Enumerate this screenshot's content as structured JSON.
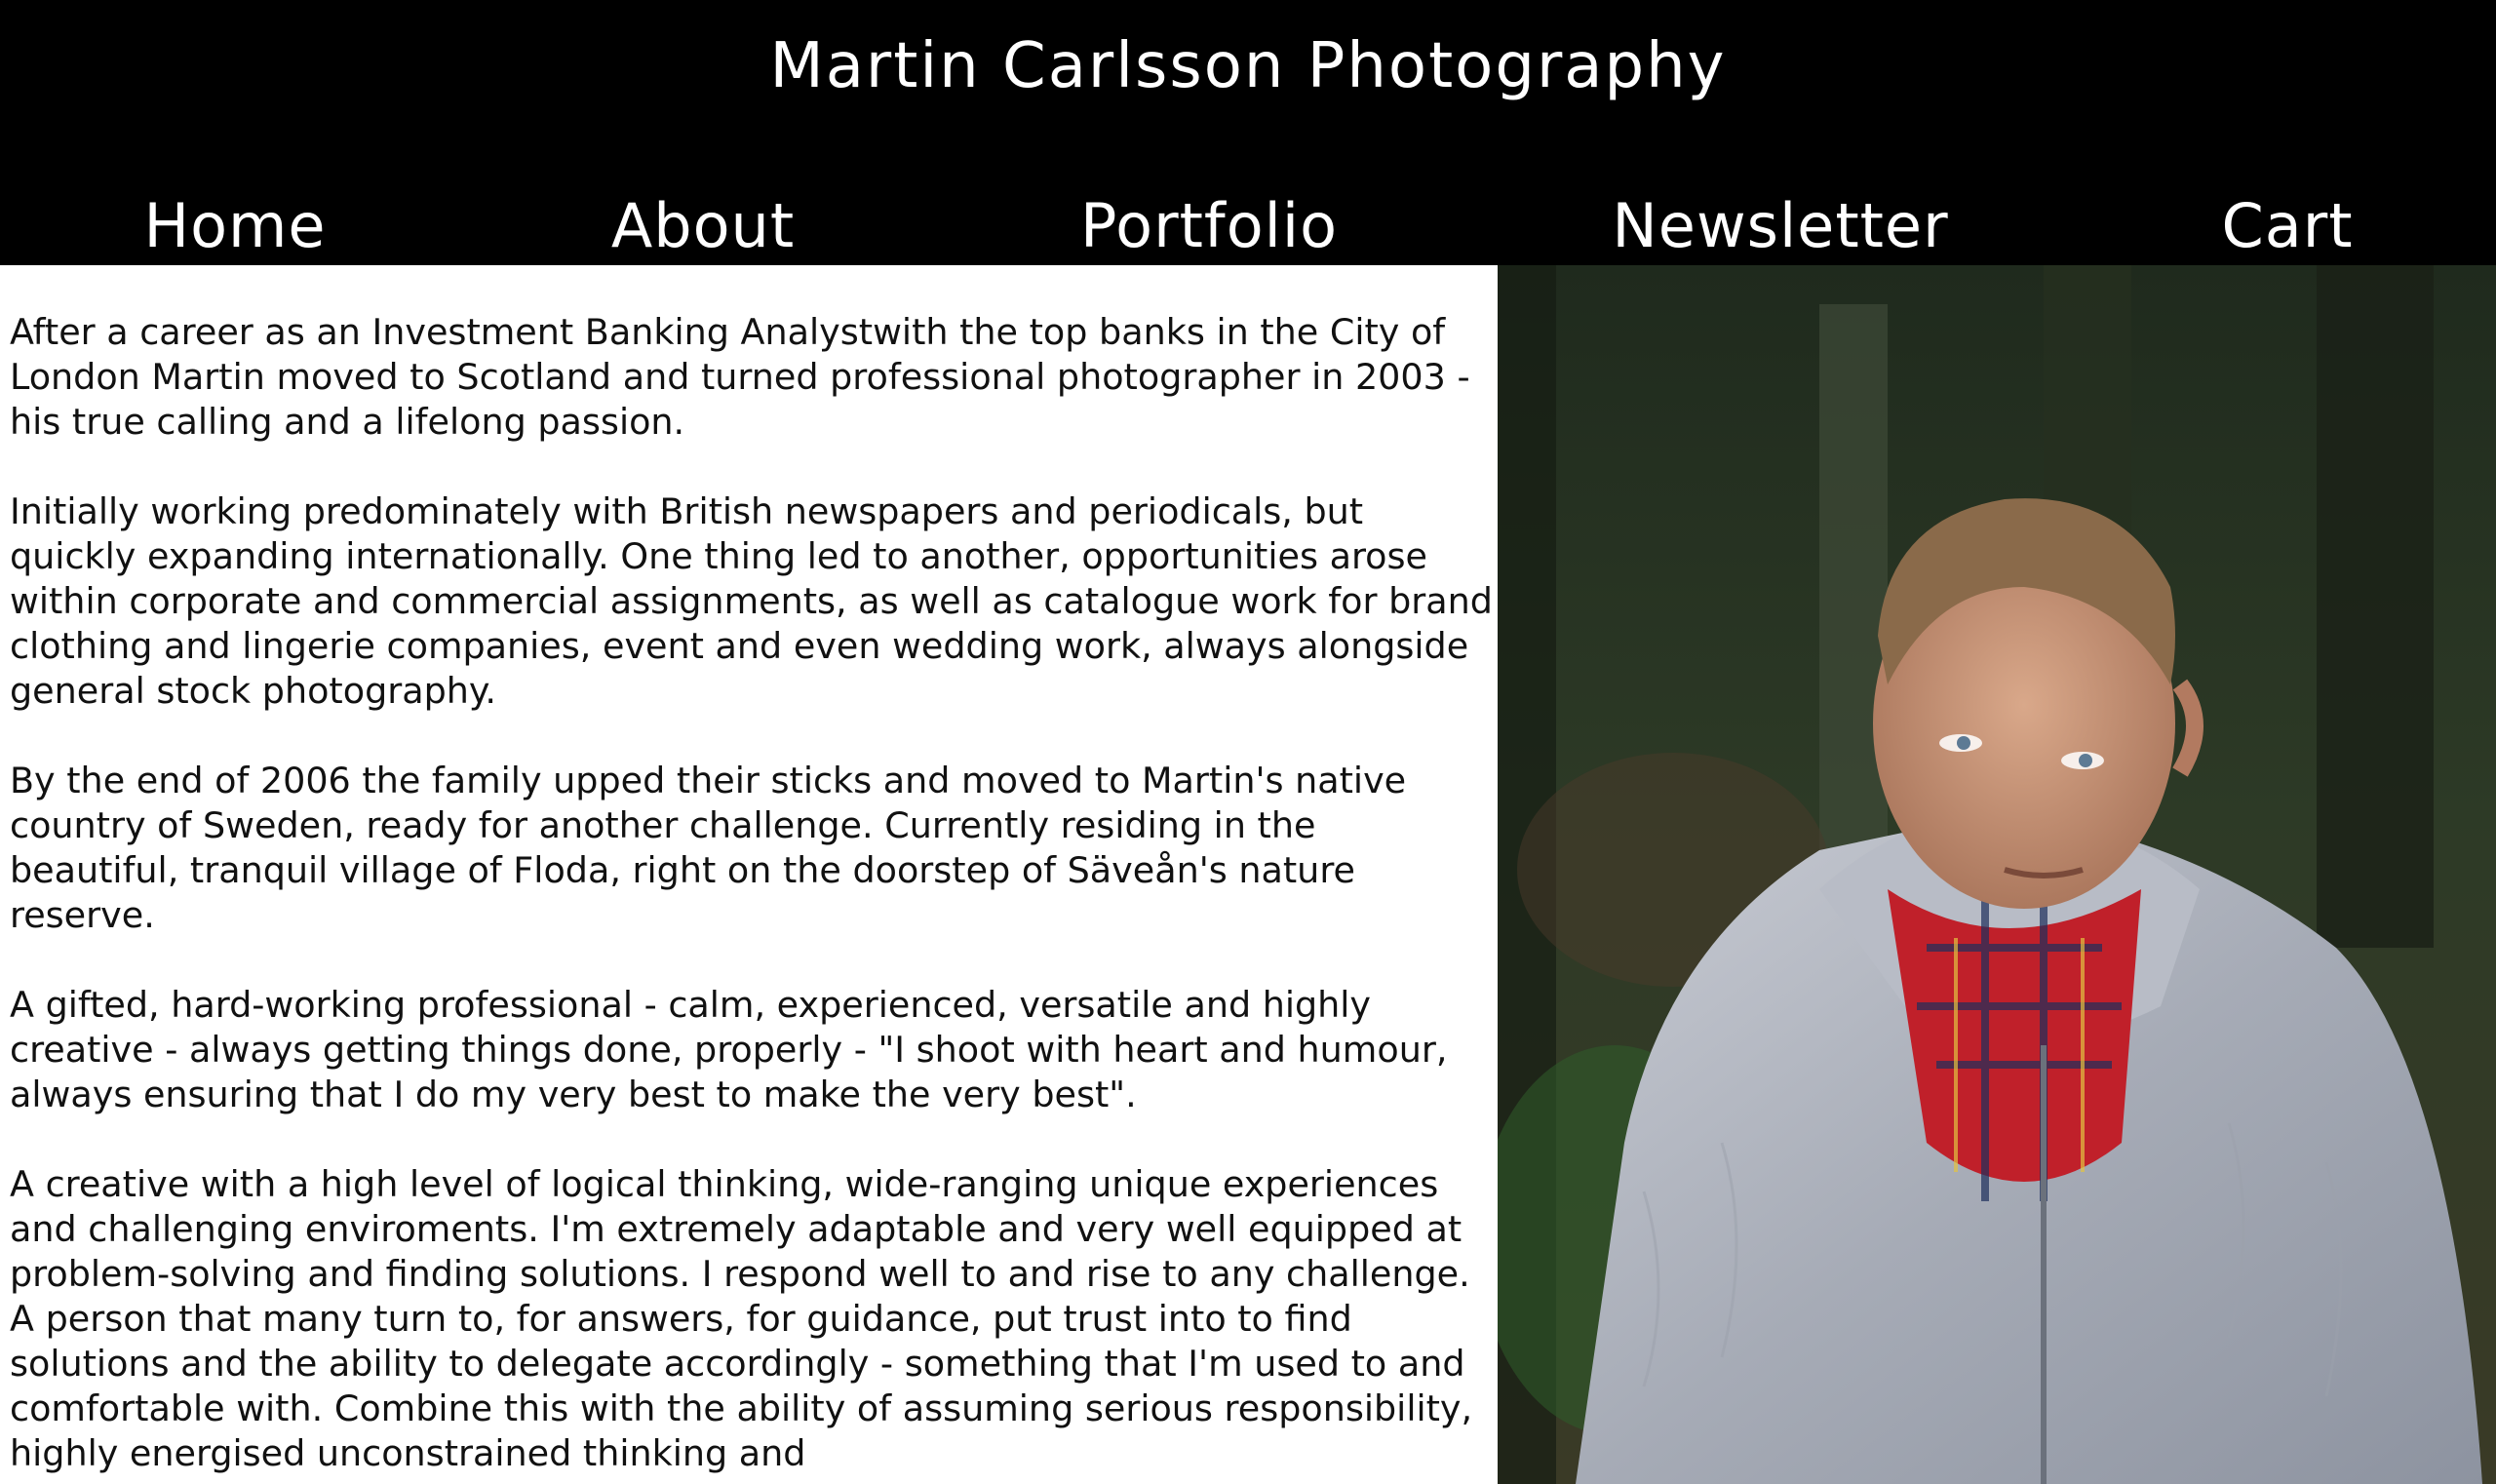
{
  "site": {
    "title": "Martin Carlsson Photography"
  },
  "nav": {
    "items": [
      {
        "label": "Home"
      },
      {
        "label": "About"
      },
      {
        "label": "Portfolio"
      },
      {
        "label": "Newsletter"
      },
      {
        "label": "Cart"
      }
    ]
  },
  "about": {
    "paragraphs": [
      "After a career as an Investment Banking Analystwith the top banks in the City of London Martin moved to Scotland and turned professional photographer in 2003 - his true calling and a lifelong passion.",
      "Initially working predominately with British newspapers and periodicals, but quickly expanding internationally. One thing led to another, opportunities arose within corporate and commercial assignments, as well as catalogue work for brand clothing and lingerie companies, event and even wedding work, always alongside general stock photography.",
      "By the end of 2006 the family upped their sticks and moved to Martin's native country of Sweden, ready for another challenge. Currently residing in the beautiful, tranquil village of Floda, right on the doorstep of Säveån's nature reserve.",
      "A gifted, hard-working professional - calm, experienced, versatile and highly creative - always getting things done, properly - \"I shoot with heart and humour, always ensuring that I do my very best to make the very best\".",
      "A creative with a high level of logical thinking, wide-ranging unique experiences and challenging enviroments. I'm extremely adaptable and very well equipped at problem-solving and finding solutions. I respond well to and rise to any challenge. A person that many turn to, for answers, for guidance, put trust into to find solutions and the ability to delegate accordingly - something that I'm used to and comfortable with. Combine this with the ability of assuming serious responsibility, highly energised unconstrained thinking and"
    ]
  },
  "colors": {
    "header_bg": "#000000",
    "header_text": "#ffffff",
    "body_text": "#111111"
  }
}
